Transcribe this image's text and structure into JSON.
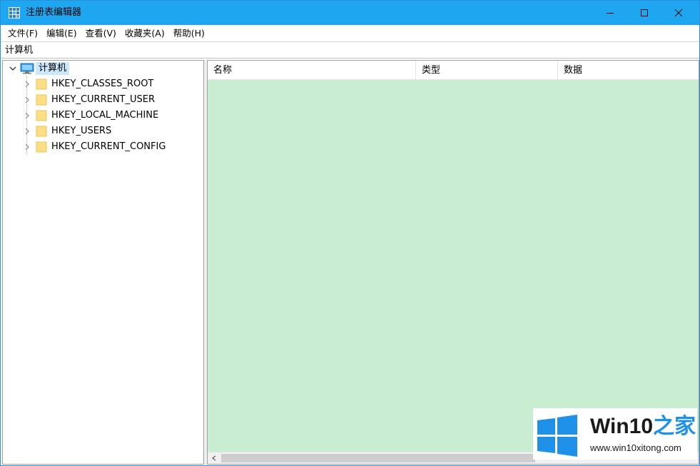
{
  "window": {
    "title": "注册表编辑器",
    "accent_color": "#1ea7f0"
  },
  "menu": [
    {
      "label": "文件(F)"
    },
    {
      "label": "编辑(E)"
    },
    {
      "label": "查看(V)"
    },
    {
      "label": "收藏夹(A)"
    },
    {
      "label": "帮助(H)"
    }
  ],
  "address": {
    "path": "计算机"
  },
  "tree": {
    "root": {
      "label": "计算机",
      "icon": "computer-icon",
      "expanded": true,
      "selected": true
    },
    "children": [
      {
        "label": "HKEY_CLASSES_ROOT",
        "icon": "folder-icon"
      },
      {
        "label": "HKEY_CURRENT_USER",
        "icon": "folder-icon"
      },
      {
        "label": "HKEY_LOCAL_MACHINE",
        "icon": "folder-icon"
      },
      {
        "label": "HKEY_USERS",
        "icon": "folder-icon"
      },
      {
        "label": "HKEY_CURRENT_CONFIG",
        "icon": "folder-icon"
      }
    ]
  },
  "list": {
    "columns": [
      {
        "label": "名称"
      },
      {
        "label": "类型"
      },
      {
        "label": "数据"
      }
    ],
    "background_color": "#c8edd0"
  },
  "watermark": {
    "brand_main": "Win10",
    "brand_suffix": "之家",
    "url": "www.win10xitong.com",
    "logo_color": "#1e90e8"
  }
}
